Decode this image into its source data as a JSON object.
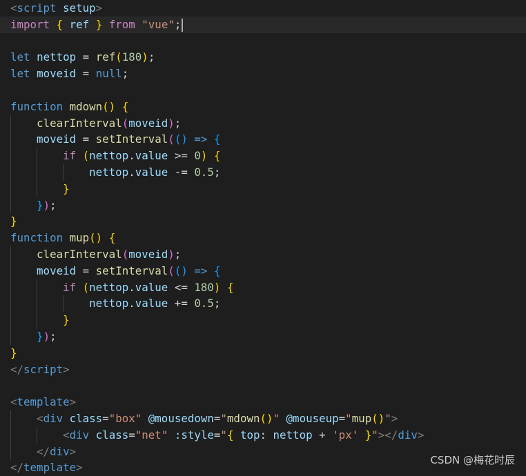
{
  "watermark": "CSDN @梅花时辰",
  "colors": {
    "background": "#1e1e1e",
    "keyword_control": "#c586c0",
    "keyword_decl": "#569cd6",
    "variable": "#9cdcfe",
    "function": "#dcdcaa",
    "number": "#b5cea8",
    "string": "#ce9178",
    "bracket_level1": "#ffd700",
    "bracket_level2": "#da70d6",
    "bracket_level3": "#179fff"
  },
  "code_lines": [
    {
      "guides": 0,
      "tokens": [
        [
          "punct",
          "<"
        ],
        [
          "tag",
          "script"
        ],
        [
          "attr",
          " setup"
        ],
        [
          "punct",
          ">"
        ]
      ]
    },
    {
      "guides": 0,
      "current": true,
      "cursor": true,
      "tokens": [
        [
          "kw",
          "import"
        ],
        [
          "op",
          " "
        ],
        [
          "br1",
          "{"
        ],
        [
          "op",
          " "
        ],
        [
          "var",
          "ref"
        ],
        [
          "op",
          " "
        ],
        [
          "br1",
          "}"
        ],
        [
          "op",
          " "
        ],
        [
          "kw",
          "from"
        ],
        [
          "op",
          " "
        ],
        [
          "str",
          "\"vue\""
        ],
        [
          "op",
          ";"
        ]
      ]
    },
    {
      "guides": 0,
      "tokens": []
    },
    {
      "guides": 0,
      "tokens": [
        [
          "decl",
          "let"
        ],
        [
          "op",
          " "
        ],
        [
          "var",
          "nettop"
        ],
        [
          "op",
          " = "
        ],
        [
          "fn",
          "ref"
        ],
        [
          "br1",
          "("
        ],
        [
          "num",
          "180"
        ],
        [
          "br1",
          ")"
        ],
        [
          "op",
          ";"
        ]
      ]
    },
    {
      "guides": 0,
      "tokens": [
        [
          "decl",
          "let"
        ],
        [
          "op",
          " "
        ],
        [
          "var",
          "moveid"
        ],
        [
          "op",
          " = "
        ],
        [
          "decl",
          "null"
        ],
        [
          "op",
          ";"
        ]
      ]
    },
    {
      "guides": 0,
      "tokens": []
    },
    {
      "guides": 0,
      "tokens": [
        [
          "decl",
          "function"
        ],
        [
          "op",
          " "
        ],
        [
          "fn",
          "mdown"
        ],
        [
          "br1",
          "()"
        ],
        [
          "op",
          " "
        ],
        [
          "br1",
          "{"
        ]
      ]
    },
    {
      "guides": 1,
      "tokens": [
        [
          "op",
          "    "
        ],
        [
          "fn",
          "clearInterval"
        ],
        [
          "br2",
          "("
        ],
        [
          "var",
          "moveid"
        ],
        [
          "br2",
          ")"
        ],
        [
          "op",
          ";"
        ]
      ]
    },
    {
      "guides": 1,
      "tokens": [
        [
          "op",
          "    "
        ],
        [
          "var",
          "moveid"
        ],
        [
          "op",
          " = "
        ],
        [
          "fn",
          "setInterval"
        ],
        [
          "br2",
          "("
        ],
        [
          "br3",
          "()"
        ],
        [
          "op",
          " "
        ],
        [
          "decl",
          "=>"
        ],
        [
          "op",
          " "
        ],
        [
          "br3",
          "{"
        ]
      ]
    },
    {
      "guides": 2,
      "tokens": [
        [
          "op",
          "        "
        ],
        [
          "kw",
          "if"
        ],
        [
          "op",
          " "
        ],
        [
          "br1",
          "("
        ],
        [
          "var",
          "nettop"
        ],
        [
          "op",
          "."
        ],
        [
          "var",
          "value"
        ],
        [
          "op",
          " >= "
        ],
        [
          "num",
          "0"
        ],
        [
          "br1",
          ")"
        ],
        [
          "op",
          " "
        ],
        [
          "br1",
          "{"
        ]
      ]
    },
    {
      "guides": 3,
      "tokens": [
        [
          "op",
          "            "
        ],
        [
          "var",
          "nettop"
        ],
        [
          "op",
          "."
        ],
        [
          "var",
          "value"
        ],
        [
          "op",
          " -= "
        ],
        [
          "num",
          "0.5"
        ],
        [
          "op",
          ";"
        ]
      ]
    },
    {
      "guides": 2,
      "tokens": [
        [
          "op",
          "        "
        ],
        [
          "br1",
          "}"
        ]
      ]
    },
    {
      "guides": 1,
      "tokens": [
        [
          "op",
          "    "
        ],
        [
          "br3",
          "}"
        ],
        [
          "br2",
          ")"
        ],
        [
          "op",
          ";"
        ]
      ]
    },
    {
      "guides": 0,
      "tokens": [
        [
          "br1",
          "}"
        ]
      ]
    },
    {
      "guides": 0,
      "tokens": [
        [
          "decl",
          "function"
        ],
        [
          "op",
          " "
        ],
        [
          "fn",
          "mup"
        ],
        [
          "br1",
          "()"
        ],
        [
          "op",
          " "
        ],
        [
          "br1",
          "{"
        ]
      ]
    },
    {
      "guides": 1,
      "tokens": [
        [
          "op",
          "    "
        ],
        [
          "fn",
          "clearInterval"
        ],
        [
          "br2",
          "("
        ],
        [
          "var",
          "moveid"
        ],
        [
          "br2",
          ")"
        ],
        [
          "op",
          ";"
        ]
      ]
    },
    {
      "guides": 1,
      "tokens": [
        [
          "op",
          "    "
        ],
        [
          "var",
          "moveid"
        ],
        [
          "op",
          " = "
        ],
        [
          "fn",
          "setInterval"
        ],
        [
          "br2",
          "("
        ],
        [
          "br3",
          "()"
        ],
        [
          "op",
          " "
        ],
        [
          "decl",
          "=>"
        ],
        [
          "op",
          " "
        ],
        [
          "br3",
          "{"
        ]
      ]
    },
    {
      "guides": 2,
      "tokens": [
        [
          "op",
          "        "
        ],
        [
          "kw",
          "if"
        ],
        [
          "op",
          " "
        ],
        [
          "br1",
          "("
        ],
        [
          "var",
          "nettop"
        ],
        [
          "op",
          "."
        ],
        [
          "var",
          "value"
        ],
        [
          "op",
          " <= "
        ],
        [
          "num",
          "180"
        ],
        [
          "br1",
          ")"
        ],
        [
          "op",
          " "
        ],
        [
          "br1",
          "{"
        ]
      ]
    },
    {
      "guides": 3,
      "tokens": [
        [
          "op",
          "            "
        ],
        [
          "var",
          "nettop"
        ],
        [
          "op",
          "."
        ],
        [
          "var",
          "value"
        ],
        [
          "op",
          " += "
        ],
        [
          "num",
          "0.5"
        ],
        [
          "op",
          ";"
        ]
      ]
    },
    {
      "guides": 2,
      "tokens": [
        [
          "op",
          "        "
        ],
        [
          "br1",
          "}"
        ]
      ]
    },
    {
      "guides": 1,
      "tokens": [
        [
          "op",
          "    "
        ],
        [
          "br3",
          "}"
        ],
        [
          "br2",
          ")"
        ],
        [
          "op",
          ";"
        ]
      ]
    },
    {
      "guides": 0,
      "tokens": [
        [
          "br1",
          "}"
        ]
      ]
    },
    {
      "guides": 0,
      "tokens": [
        [
          "punct",
          "</"
        ],
        [
          "tag",
          "script"
        ],
        [
          "punct",
          ">"
        ]
      ]
    },
    {
      "guides": 0,
      "tokens": []
    },
    {
      "guides": 0,
      "tokens": [
        [
          "punct",
          "<"
        ],
        [
          "tag",
          "template"
        ],
        [
          "punct",
          ">"
        ]
      ]
    },
    {
      "guides": 1,
      "tokens": [
        [
          "op",
          "    "
        ],
        [
          "punct",
          "<"
        ],
        [
          "tag",
          "div"
        ],
        [
          "op",
          " "
        ],
        [
          "attr",
          "class"
        ],
        [
          "op",
          "="
        ],
        [
          "str",
          "\"box\""
        ],
        [
          "op",
          " "
        ],
        [
          "attr",
          "@mousedown"
        ],
        [
          "op",
          "="
        ],
        [
          "str",
          "\""
        ],
        [
          "fn",
          "mdown"
        ],
        [
          "br1",
          "()"
        ],
        [
          "str",
          "\""
        ],
        [
          "op",
          " "
        ],
        [
          "attr",
          "@mouseup"
        ],
        [
          "op",
          "="
        ],
        [
          "str",
          "\""
        ],
        [
          "fn",
          "mup"
        ],
        [
          "br1",
          "()"
        ],
        [
          "str",
          "\""
        ],
        [
          "punct",
          ">"
        ]
      ]
    },
    {
      "guides": 2,
      "tokens": [
        [
          "op",
          "        "
        ],
        [
          "punct",
          "<"
        ],
        [
          "tag",
          "div"
        ],
        [
          "op",
          " "
        ],
        [
          "attr",
          "class"
        ],
        [
          "op",
          "="
        ],
        [
          "str",
          "\"net\""
        ],
        [
          "op",
          " "
        ],
        [
          "attr",
          ":style"
        ],
        [
          "op",
          "="
        ],
        [
          "str",
          "\""
        ],
        [
          "br1",
          "{"
        ],
        [
          "op",
          " "
        ],
        [
          "var",
          "top"
        ],
        [
          "op",
          ": "
        ],
        [
          "var",
          "nettop"
        ],
        [
          "op",
          " + "
        ],
        [
          "str",
          "'px'"
        ],
        [
          "op",
          " "
        ],
        [
          "br1",
          "}"
        ],
        [
          "str",
          "\""
        ],
        [
          "punct",
          "></"
        ],
        [
          "tag",
          "div"
        ],
        [
          "punct",
          ">"
        ]
      ]
    },
    {
      "guides": 1,
      "tokens": [
        [
          "op",
          "    "
        ],
        [
          "punct",
          "</"
        ],
        [
          "tag",
          "div"
        ],
        [
          "punct",
          ">"
        ]
      ]
    },
    {
      "guides": 0,
      "tokens": [
        [
          "punct",
          "</"
        ],
        [
          "tag",
          "template"
        ],
        [
          "punct",
          ">"
        ]
      ]
    }
  ]
}
